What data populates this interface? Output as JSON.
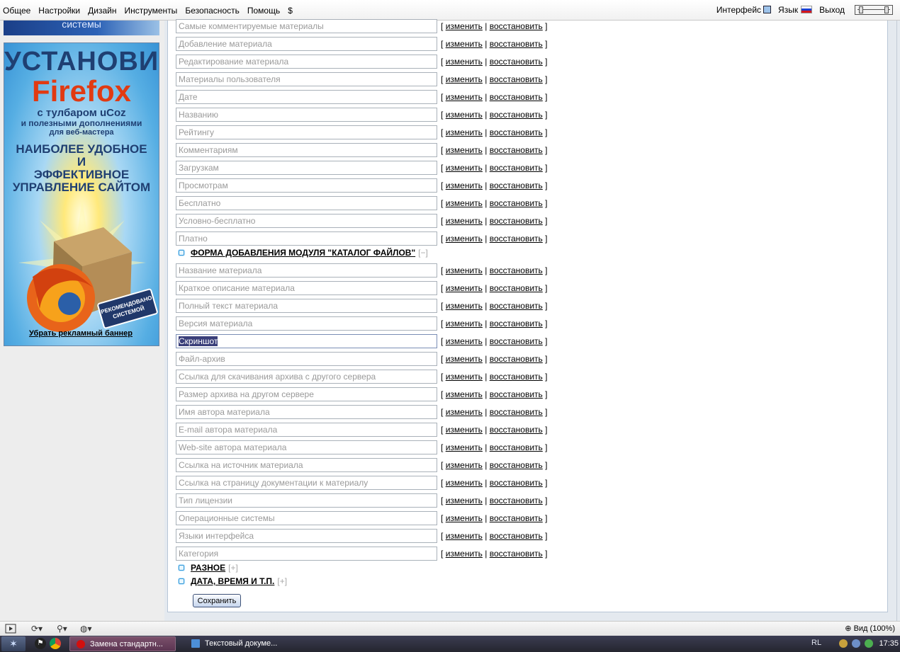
{
  "topbar": {
    "menu": [
      "Общее",
      "Настройки",
      "Дизайн",
      "Инструменты",
      "Безопасность",
      "Помощь",
      "$"
    ],
    "interface_label": "Интерфейс",
    "language_label": "Язык",
    "exit_label": "Выход"
  },
  "sidebar": {
    "banner_top_text": "системы",
    "banner": {
      "line1": "УСТАНОВИ",
      "line2": "Firefox",
      "line3": "с тулбаром uCoz",
      "line4": "и полезными дополнениями",
      "line5": "для веб-мастера",
      "line6": "НАИБОЛЕЕ УДОБНОЕ",
      "line7": "И",
      "line8": "ЭФФЕКТИВНОЕ",
      "line9": "УПРАВЛЕНИЕ САЙТОМ",
      "stamp_line1": "РЕКОМЕНДОВАНО",
      "stamp_line2": "СИСТЕМОЙ"
    },
    "remove_banner_link": "Убрать рекламный баннер"
  },
  "actions": {
    "open_bracket": "[",
    "separator": "|",
    "close_bracket": "]",
    "edit": "изменить",
    "restore": "восстановить"
  },
  "fields_group1": [
    "Самые комментируемые материалы",
    "Добавление материала",
    "Редактирование материала",
    "Материалы пользователя",
    "Дате",
    "Названию",
    "Рейтингу",
    "Комментариям",
    "Загрузкам",
    "Просмотрам",
    "Бесплатно",
    "Условно-бесплатно",
    "Платно"
  ],
  "section_form": {
    "title": "ФОРМА ДОБАВЛЕНИЯ МОДУЛЯ \"КАТАЛОГ ФАЙЛОВ\"",
    "toggle": "[−]"
  },
  "fields_group2": [
    "Название материала",
    "Краткое описание материала",
    "Полный текст материала",
    "Версия материала",
    "Скриншот",
    "Файл-архив",
    "Ссылка для скачивания архива с другого сервера",
    "Размер архива на другом сервере",
    "Имя автора материала",
    "E-mail автора материала",
    "Web-site автора материала",
    "Ссылка на источник материала",
    "Ссылка на страницу документации к материалу",
    "Тип лицензии",
    "Операционные системы",
    "Языки интерфейса",
    "Категория"
  ],
  "selected_field": "Скриншот",
  "section_misc": {
    "title": "РАЗНОЕ",
    "toggle": "[+]"
  },
  "section_datetime": {
    "title": "ДАТА, ВРЕМЯ И Т.П.",
    "toggle": "[+]"
  },
  "save_button": "Сохранить",
  "statusbar": {
    "zoom": "Вид (100%)"
  },
  "taskbar": {
    "tasks": [
      "Замена стандартн...",
      "Текстовый докуме..."
    ],
    "lang": "RL",
    "clock": "17:35"
  },
  "colors": {
    "accent_blue": "#3a9bd6",
    "selection": "#3a3f7a",
    "taskbar": "#2d2e3d",
    "firefox_orange": "#e13a12"
  }
}
